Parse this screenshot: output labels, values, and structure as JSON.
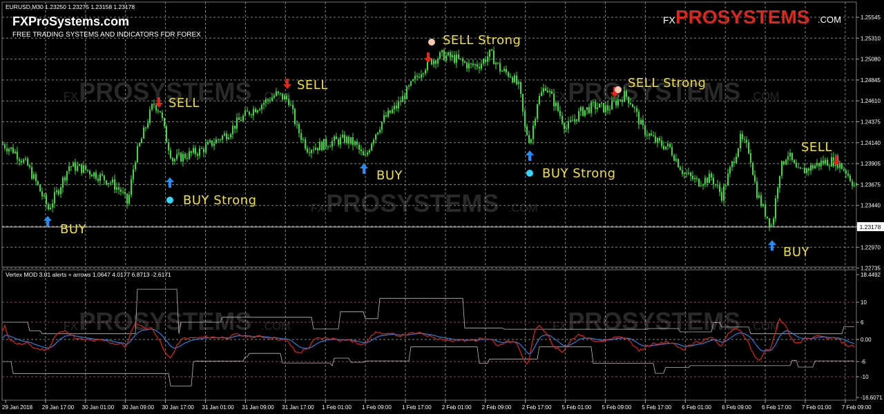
{
  "chart": {
    "symbol_line": "EURUSD,M30  1.23250 1.23275 1.23158 1.23178",
    "current_price": "1.23178",
    "colors": {
      "background": "#000000",
      "grid": "#8a8a8a",
      "bull": "#3cdc3c",
      "bear": "#3cdc3c",
      "text": "#ffffff"
    }
  },
  "branding": {
    "site": "FXProSystems.com",
    "tagline": "FREE TRADING SYSTEMS AND INDICATORS FOR FOREX",
    "logo_fx": "FX",
    "logo_main": "PROSYSTEMS",
    "logo_com": ".COM",
    "colors": {
      "fx": "#ffffff",
      "pro": "#e0261b",
      "systems": "#ffffff"
    }
  },
  "watermark": {
    "fx": "FX",
    "main": "PROSYSTEMS",
    "com": ".COM"
  },
  "indicator": {
    "title": "Vertex MOD 3.01 alerts + arrows 1.0647 4.0177 6.8713 -2.6171",
    "colors": {
      "fast": "#e0261b",
      "slow": "#2f7fe0",
      "band": "#bdbdbd",
      "level": "#b04040"
    }
  },
  "chart_data": {
    "type": "candlestick",
    "price_axis_labels": [
      "1.25545",
      "1.25310",
      "1.25080",
      "1.24845",
      "1.24610",
      "1.24375",
      "1.24140",
      "1.23905",
      "1.23675",
      "1.23440",
      "1.23210",
      "1.22970",
      "1.22735"
    ],
    "indicator_axis_labels": [
      "18.4492",
      "10",
      "6",
      "0.00",
      "-6",
      "-10",
      "-16.6071"
    ],
    "time_labels": [
      "29 Jan 2018",
      "29 Jan 17:00",
      "30 Jan 01:00",
      "30 Jan 09:00",
      "30 Jan 17:00",
      "31 Jan 01:00",
      "31 Jan 09:00",
      "31 Jan 17:00",
      "1 Feb 01:00",
      "1 Feb 09:00",
      "1 Feb 17:00",
      "2 Feb 01:00",
      "2 Feb 09:00",
      "2 Feb 17:00",
      "5 Feb 01:00",
      "5 Feb 09:00",
      "5 Feb 17:00",
      "6 Feb 01:00",
      "6 Feb 09:00",
      "6 Feb 17:00",
      "7 Feb 01:00",
      "7 Feb 09:00"
    ],
    "close_path": [
      [
        0,
        1.2414
      ],
      [
        20,
        1.2405
      ],
      [
        40,
        1.2388
      ],
      [
        55,
        1.2365
      ],
      [
        70,
        1.234
      ],
      [
        85,
        1.2362
      ],
      [
        100,
        1.2388
      ],
      [
        120,
        1.2385
      ],
      [
        140,
        1.2378
      ],
      [
        160,
        1.237
      ],
      [
        175,
        1.236
      ],
      [
        185,
        1.2345
      ],
      [
        195,
        1.2395
      ],
      [
        210,
        1.243
      ],
      [
        222,
        1.2458
      ],
      [
        232,
        1.245
      ],
      [
        240,
        1.242
      ],
      [
        250,
        1.2395
      ],
      [
        270,
        1.24
      ],
      [
        290,
        1.2405
      ],
      [
        310,
        1.2415
      ],
      [
        330,
        1.2425
      ],
      [
        345,
        1.2438
      ],
      [
        360,
        1.2448
      ],
      [
        380,
        1.2458
      ],
      [
        400,
        1.2468
      ],
      [
        418,
        1.2462
      ],
      [
        430,
        1.243
      ],
      [
        445,
        1.2408
      ],
      [
        460,
        1.241
      ],
      [
        480,
        1.2415
      ],
      [
        500,
        1.2418
      ],
      [
        515,
        1.2412
      ],
      [
        528,
        1.2395
      ],
      [
        540,
        1.242
      ],
      [
        555,
        1.244
      ],
      [
        575,
        1.2455
      ],
      [
        595,
        1.2478
      ],
      [
        610,
        1.2495
      ],
      [
        622,
        1.2505
      ],
      [
        640,
        1.2512
      ],
      [
        660,
        1.2508
      ],
      [
        680,
        1.25
      ],
      [
        695,
        1.2502
      ],
      [
        710,
        1.2514
      ],
      [
        725,
        1.2495
      ],
      [
        740,
        1.249
      ],
      [
        752,
        1.2475
      ],
      [
        760,
        1.243
      ],
      [
        768,
        1.2415
      ],
      [
        778,
        1.246
      ],
      [
        790,
        1.2478
      ],
      [
        805,
        1.2455
      ],
      [
        820,
        1.243
      ],
      [
        840,
        1.2448
      ],
      [
        860,
        1.2455
      ],
      [
        880,
        1.2452
      ],
      [
        892,
        1.246
      ],
      [
        905,
        1.2468
      ],
      [
        915,
        1.2458
      ],
      [
        930,
        1.243
      ],
      [
        950,
        1.2415
      ],
      [
        970,
        1.2408
      ],
      [
        990,
        1.238
      ],
      [
        1010,
        1.237
      ],
      [
        1030,
        1.2375
      ],
      [
        1045,
        1.2355
      ],
      [
        1060,
        1.239
      ],
      [
        1072,
        1.2418
      ],
      [
        1085,
        1.2405
      ],
      [
        1095,
        1.236
      ],
      [
        1105,
        1.234
      ],
      [
        1118,
        1.232
      ],
      [
        1128,
        1.238
      ],
      [
        1140,
        1.2403
      ],
      [
        1155,
        1.238
      ],
      [
        1170,
        1.2385
      ],
      [
        1190,
        1.2392
      ],
      [
        1210,
        1.2394
      ],
      [
        1225,
        1.2382
      ],
      [
        1238,
        1.2365
      ]
    ],
    "signals": [
      {
        "type": "BUY",
        "label": "BUY",
        "color": "#1f8fff"
      },
      {
        "type": "SELL",
        "label": "SELL",
        "color": "#e0261b"
      },
      {
        "type": "BUY_STRONG",
        "label": "BUY Strong",
        "color": "#1f8fff",
        "dot": "#36d6ff"
      },
      {
        "type": "SELL",
        "label": "SELL",
        "color": "#e0261b"
      },
      {
        "type": "BUY",
        "label": "BUY",
        "color": "#1f8fff"
      },
      {
        "type": "SELL_STRONG",
        "label": "SELL Strong",
        "color": "#e0261b",
        "dot": "#f7c9b0"
      },
      {
        "type": "BUY_STRONG",
        "label": "BUY Strong",
        "color": "#1f8fff",
        "dot": "#36d6ff"
      },
      {
        "type": "SELL_STRONG",
        "label": "SELL Strong",
        "color": "#e0261b",
        "dot": "#f7c9b0"
      },
      {
        "type": "BUY",
        "label": "BUY",
        "color": "#1f8fff"
      },
      {
        "type": "SELL",
        "label": "SELL",
        "color": "#e0261b"
      }
    ],
    "signal_label_color": "#f0e03a"
  }
}
